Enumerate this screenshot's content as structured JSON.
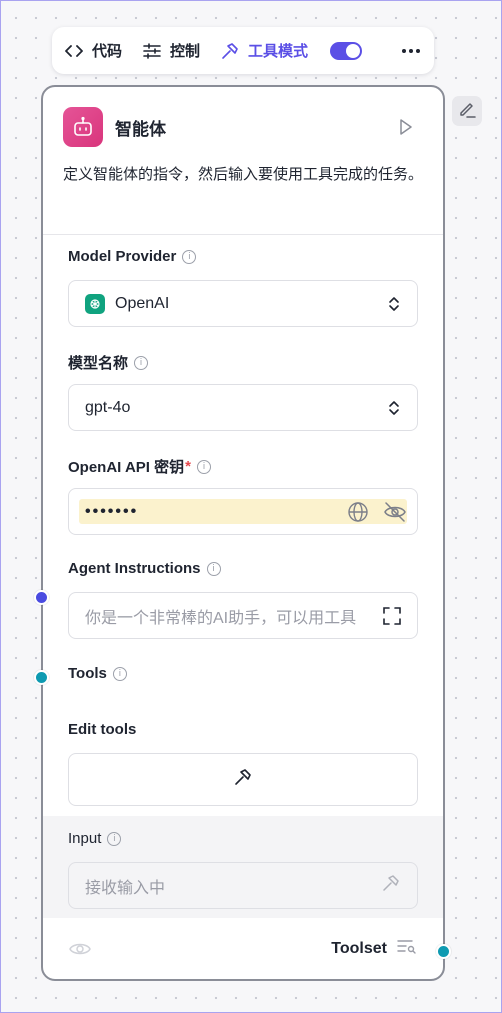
{
  "toolbar": {
    "code_label": "代码",
    "control_label": "控制",
    "tool_mode_label": "工具模式",
    "tool_mode_enabled": true
  },
  "node": {
    "title": "智能体",
    "description": "定义智能体的指令，然后输入要使用工具完成的任务。",
    "icon": "robot-icon",
    "accent": "#d9357c"
  },
  "fields": {
    "model_provider": {
      "label": "Model Provider",
      "value": "OpenAI"
    },
    "model_name": {
      "label": "模型名称",
      "value": "gpt-4o"
    },
    "api_key": {
      "label": "OpenAI API 密钥",
      "required_mark": "*",
      "value": "•••••••"
    },
    "agent_instructions": {
      "label": "Agent Instructions",
      "placeholder": "你是一个非常棒的AI助手，可以用工具"
    },
    "tools": {
      "label": "Tools"
    },
    "edit_tools": {
      "label": "Edit tools"
    },
    "input": {
      "label": "Input",
      "placeholder": "接收输入中"
    }
  },
  "footer": {
    "toolset_label": "Toolset"
  },
  "colors": {
    "primary": "#5b4fe6",
    "handle_left_top": "#4a4be0",
    "handle_teal": "#0e9ab1",
    "openai_green": "#10a37f",
    "password_bg": "#fbf2cd"
  }
}
